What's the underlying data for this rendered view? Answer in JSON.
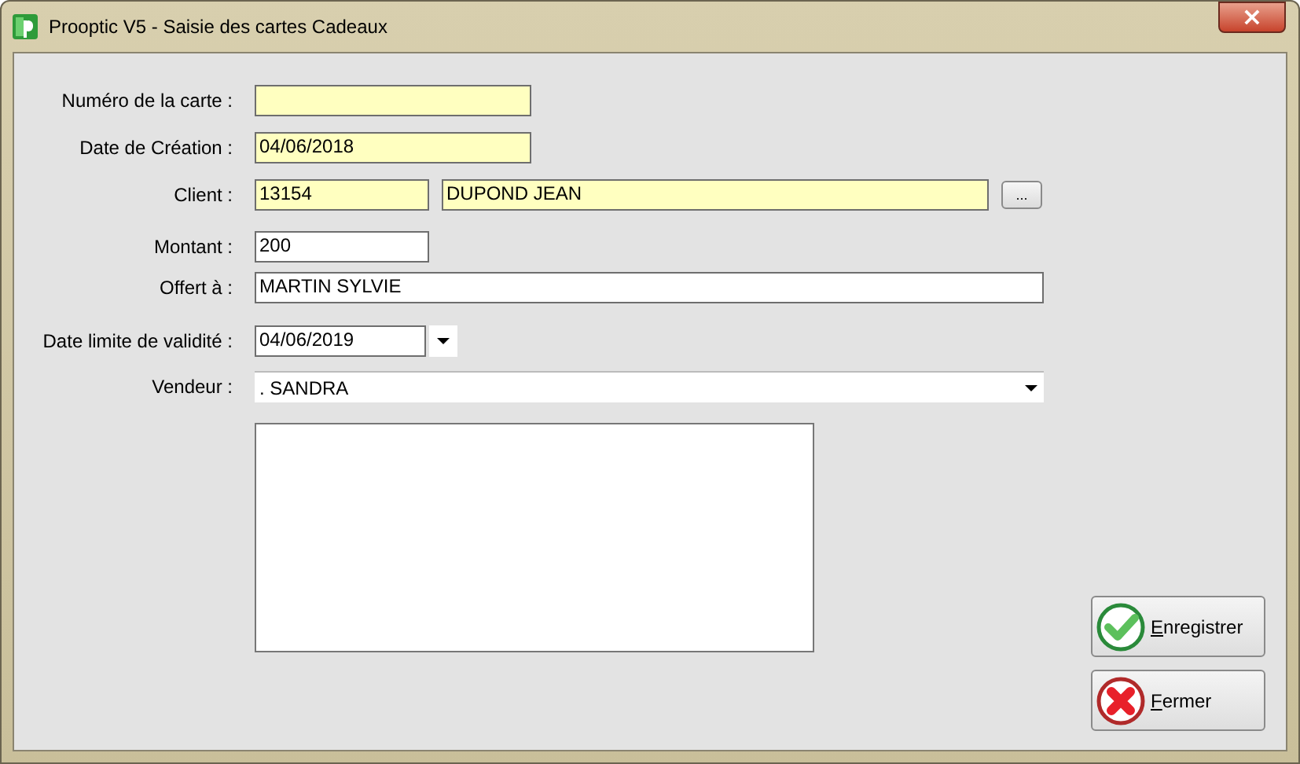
{
  "window": {
    "title": "Prooptic V5 - Saisie des cartes Cadeaux",
    "close_button": "×"
  },
  "form": {
    "card_number": {
      "label": "Numéro de la carte :",
      "required": true
    },
    "creation_date": {
      "label": "Date de Création :",
      "value": "04/06/2018",
      "required": true
    },
    "client": {
      "label": "Client :",
      "code": "13154",
      "name": "DUPOND JEAN",
      "required": true,
      "browse_button": "..."
    },
    "amount": {
      "label": "Montant :",
      "value": "200",
      "required": false
    },
    "offered_to": {
      "label": "Offert à :",
      "value": "MARTIN SYLVIE",
      "required": false
    },
    "expiry_date": {
      "label": "Date limite de validité :",
      "value": "04/06/2019"
    },
    "seller": {
      "label": "Vendeur :",
      "value": ". SANDRA"
    }
  },
  "buttons": [
    {
      "kind": "save",
      "label": "Enregistrer"
    },
    {
      "kind": "close",
      "label": "Fermer"
    }
  ]
}
